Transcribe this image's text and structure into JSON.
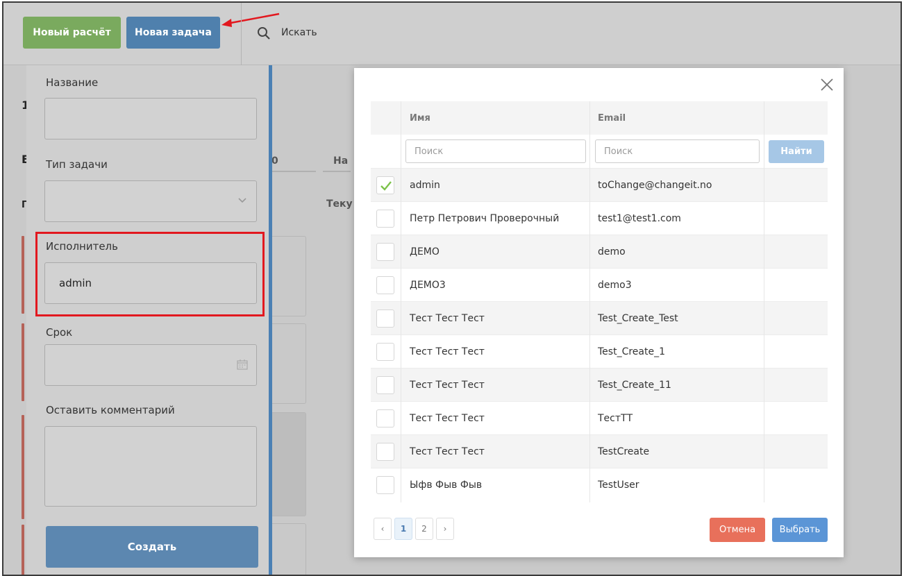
{
  "toolbar": {
    "new_calc_label": "Новый расчёт",
    "new_task_label": "Новая задача",
    "search_label": "Искать"
  },
  "form": {
    "name_label": "Название",
    "task_type_label": "Тип задачи",
    "assignee_label": "Исполнитель",
    "assignee_value": "admin",
    "due_label": "Срок",
    "comment_label": "Оставить комментарий",
    "create_label": "Создать"
  },
  "background": {
    "frag_1": "0",
    "frag_2": "На",
    "frag_3": "Теку",
    "left_char_1": "1",
    "left_char_2": "E",
    "left_char_3": "Г"
  },
  "modal": {
    "columns": {
      "name": "Имя",
      "email": "Email"
    },
    "name_search_placeholder": "Поиск",
    "email_search_placeholder": "Поиск",
    "find_label": "Найти",
    "users": [
      {
        "name": "admin",
        "email": "toChange@changeit.no",
        "checked": true
      },
      {
        "name": "Петр Петрович Проверочный",
        "email": "test1@test1.com",
        "checked": false
      },
      {
        "name": "ДЕМО",
        "email": "demo",
        "checked": false
      },
      {
        "name": "ДЕМО3",
        "email": "demo3",
        "checked": false
      },
      {
        "name": "Тест Тест Тест",
        "email": "Test_Create_Test",
        "checked": false
      },
      {
        "name": "Тест Тест Тест",
        "email": "Test_Create_1",
        "checked": false
      },
      {
        "name": "Тест Тест Тест",
        "email": "Test_Create_11",
        "checked": false
      },
      {
        "name": "Тест Тест Тест",
        "email": "ТестТТ",
        "checked": false
      },
      {
        "name": "Тест Тест Тест",
        "email": "TestCreate",
        "checked": false
      },
      {
        "name": "Ыфв Фыв Фыв",
        "email": "TestUser",
        "checked": false
      }
    ],
    "pagination": {
      "prev": "‹",
      "pages": [
        "1",
        "2"
      ],
      "current_page": "1",
      "next": "›"
    },
    "cancel_label": "Отмена",
    "select_label": "Выбрать"
  },
  "colors": {
    "green_button": "#7aaa5e",
    "blue_button": "#4f80ad",
    "highlight_box": "#e2181f",
    "cancel": "#e8705b",
    "select": "#5b95d6",
    "checkmark": "#7cc24a"
  }
}
